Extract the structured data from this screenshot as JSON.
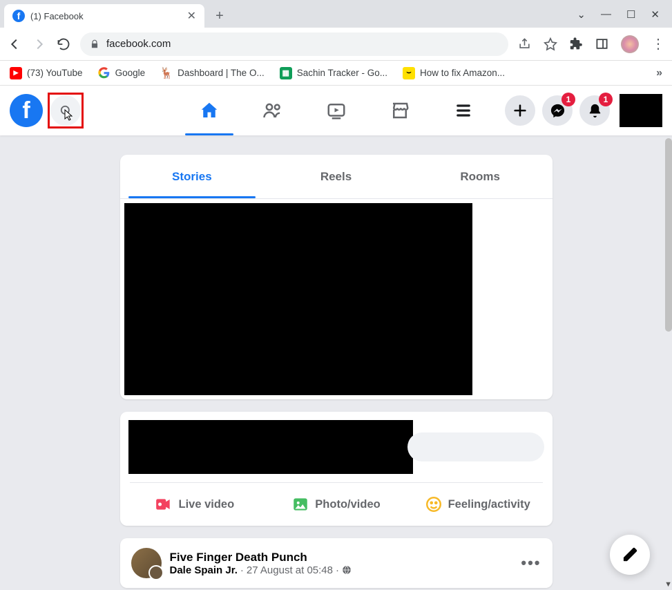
{
  "browser": {
    "tab_title": "(1) Facebook",
    "url": "facebook.com",
    "bookmarks": [
      {
        "label": "(73) YouTube"
      },
      {
        "label": "Google"
      },
      {
        "label": "Dashboard | The O..."
      },
      {
        "label": "Sachin Tracker - Go..."
      },
      {
        "label": "How to fix Amazon..."
      }
    ]
  },
  "fb_header": {
    "messenger_badge": "1",
    "notifications_badge": "1"
  },
  "stories": {
    "tabs": [
      "Stories",
      "Reels",
      "Rooms"
    ]
  },
  "composer": {
    "actions": [
      "Live video",
      "Photo/video",
      "Feeling/activity"
    ]
  },
  "feed": {
    "post": {
      "page_name": "Five Finger Death Punch",
      "author": "Dale Spain Jr.",
      "time": "27 August at 05:48"
    }
  }
}
